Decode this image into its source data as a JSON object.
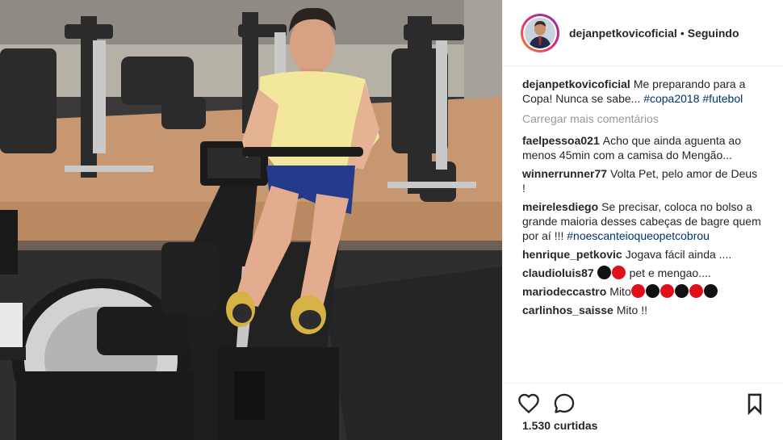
{
  "post": {
    "author": "dejanpetkovicoficial",
    "separator": "•",
    "follow_status": "Seguindo",
    "caption": {
      "user": "dejanpetkovicoficial",
      "text": "Me preparando para a Copa! Nunca se sabe...",
      "hashtags": [
        "#copa2018",
        "#futebol"
      ]
    },
    "load_more_label": "Carregar mais comentários",
    "comments": [
      {
        "user": "faelpessoa021",
        "text": "Acho que ainda aguenta ao menos 45min com a camisa do Mengão..."
      },
      {
        "user": "winnerrunner77",
        "text": "Volta Pet, pelo amor de Deus !"
      },
      {
        "user": "meirelesdiego",
        "text": "Se precisar, coloca no bolso a grande maioria desses cabeças de bagre quem por aí !!!",
        "hashtag": "#noescanteioqueopetcobrou"
      },
      {
        "user": "henrique_petkovic",
        "text": "Jogava fácil ainda ...."
      },
      {
        "user": "claudioluis87",
        "text": "pet e mengao....",
        "emojis": [
          "black",
          "red"
        ]
      },
      {
        "user": "mariodeccastro",
        "text": "Mito",
        "emojis": [
          "red",
          "black",
          "red",
          "black",
          "red",
          "black"
        ]
      },
      {
        "user": "carlinhos_saisse",
        "text": "Mito !!"
      }
    ],
    "likes_label": "1.530 curtidas",
    "icons": {
      "like": "heart-icon",
      "comment": "comment-icon",
      "save": "bookmark-icon"
    },
    "colors": {
      "hashtag": "#003569",
      "muted": "#999999",
      "text": "#262626",
      "story_ring_start": "#f58529",
      "story_ring_end": "#8134af"
    }
  }
}
